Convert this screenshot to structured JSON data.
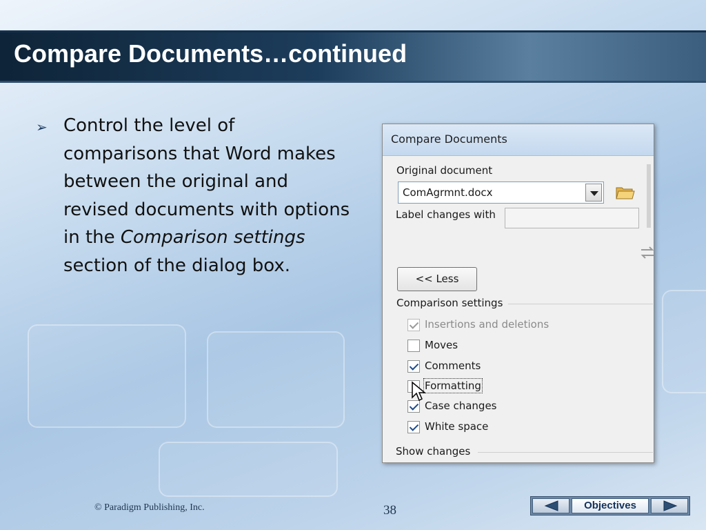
{
  "slide": {
    "title": "Compare Documents…continued",
    "bullet": {
      "text_before": "Control the level of comparisons that Word makes between the original and revised documents with options in the ",
      "emphasis": "Comparison settings",
      "text_after": " section of the dialog box."
    },
    "footer": {
      "copyright": "© Paradigm Publishing, Inc.",
      "page_number": "38"
    },
    "nav": {
      "objectives_label": "Objectives",
      "prev_icon": "triangle-left-icon",
      "next_icon": "triangle-right-icon"
    }
  },
  "dialog": {
    "title": "Compare Documents",
    "original_document_label": "Original document",
    "original_document_value": "ComAgrmnt.docx",
    "label_changes_label": "Label changes with",
    "label_changes_value": "",
    "less_button": "<< Less",
    "comparison_settings_label": "Comparison settings",
    "options": [
      {
        "label": "Insertions and deletions",
        "checked": true,
        "disabled": true
      },
      {
        "label": "Moves",
        "checked": false,
        "disabled": false
      },
      {
        "label": "Comments",
        "checked": true,
        "disabled": false
      },
      {
        "label": "Formatting",
        "checked": false,
        "disabled": false
      },
      {
        "label": "Case changes",
        "checked": true,
        "disabled": false
      },
      {
        "label": "White space",
        "checked": true,
        "disabled": false
      }
    ],
    "show_changes_label": "Show changes",
    "icons": [
      "folder-open-icon",
      "swap-arrows-icon",
      "mouse-pointer-icon"
    ]
  }
}
